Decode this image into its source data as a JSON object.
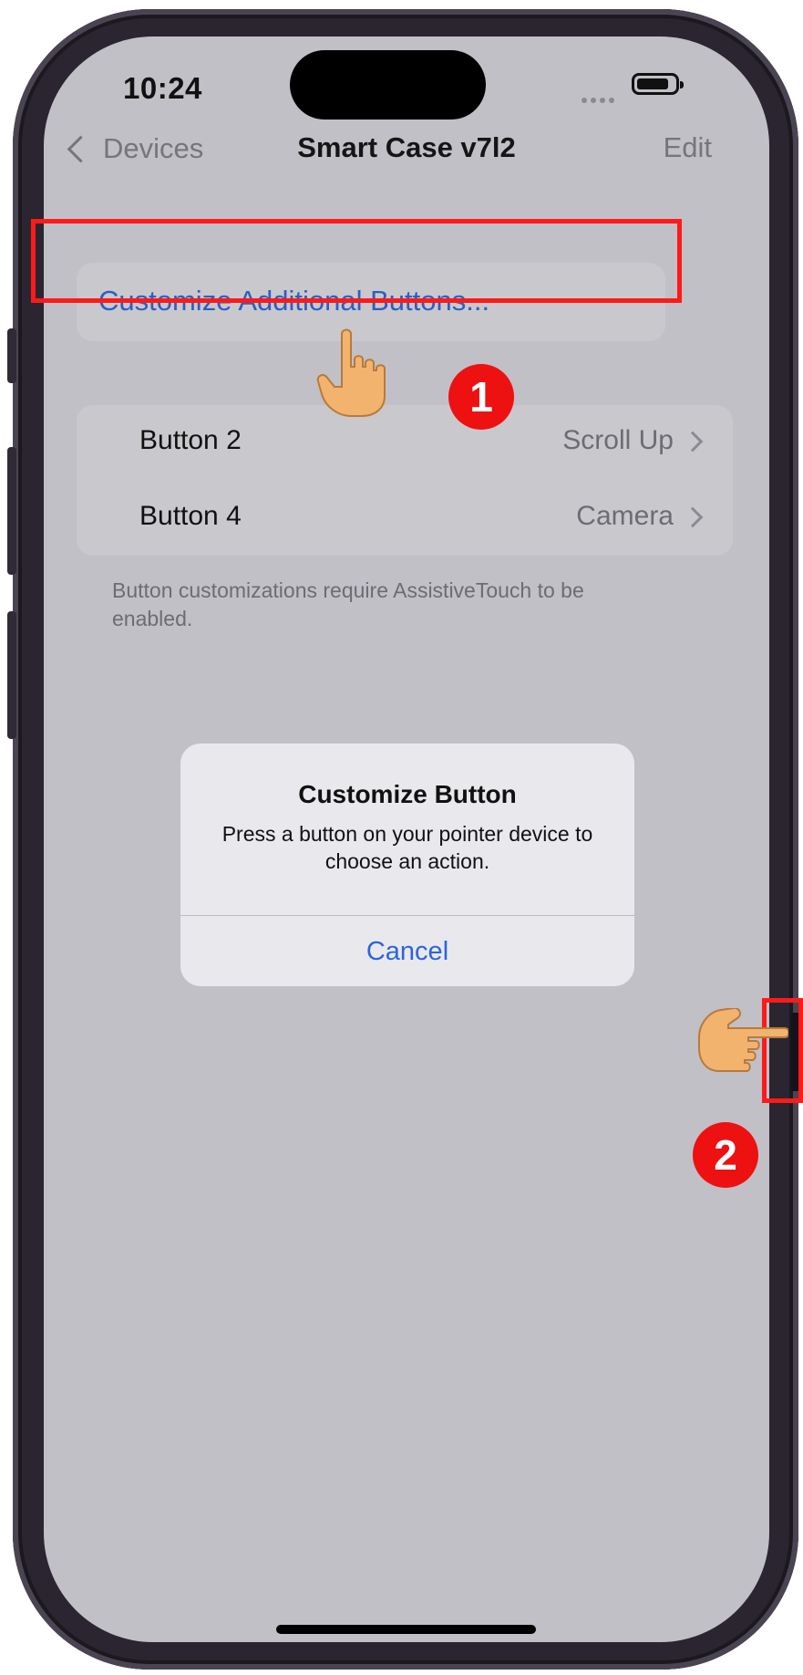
{
  "status_bar": {
    "time": "10:24"
  },
  "nav": {
    "back_label": "Devices",
    "title": "Smart Case v7l2",
    "edit_label": "Edit"
  },
  "customize_link": "Customize Additional Buttons...",
  "buttons": [
    {
      "label": "Button 2",
      "value": "Scroll Up"
    },
    {
      "label": "Button 4",
      "value": "Camera"
    }
  ],
  "footnote": "Button customizations require AssistiveTouch to be enabled.",
  "alert": {
    "title": "Customize Button",
    "message": "Press a button on your pointer device to choose an action.",
    "cancel_label": "Cancel"
  },
  "annotations": {
    "step_1": "1",
    "step_2": "2",
    "highlight_color": "#ff1a1a"
  },
  "colors": {
    "accent": "#2a66d9",
    "screen_bg": "#c1c0c6"
  },
  "icons": [
    "back-chevron-icon",
    "battery-icon",
    "signal-dots-icon",
    "chevron-right-icon",
    "pointing-hand-icon"
  ]
}
